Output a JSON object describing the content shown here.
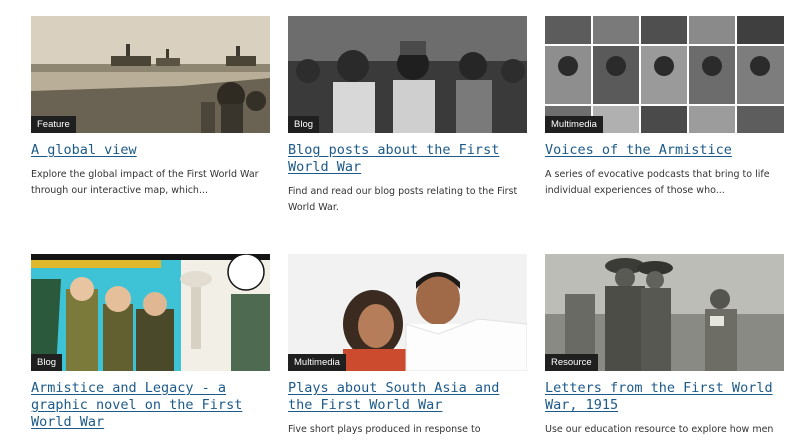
{
  "cards": [
    {
      "tag": "Feature",
      "title": "A global view",
      "description": "Explore the global impact of the First World War through our interactive map, which..."
    },
    {
      "tag": "Blog",
      "title": "Blog posts about the First World War",
      "description": "Find and read our blog posts relating to the First World War."
    },
    {
      "tag": "Multimedia",
      "title": "Voices of the Armistice",
      "description": "A series of evocative podcasts that bring to life individual experiences of those who..."
    },
    {
      "tag": "Blog",
      "title": "Armistice and Legacy - a graphic novel on the First World War",
      "description": ""
    },
    {
      "tag": "Multimedia",
      "title": "Plays about South Asia and the First World War",
      "description": "Five short plays produced in response to"
    },
    {
      "tag": "Resource",
      "title": "Letters from the First World War, 1915",
      "description": "Use our education resource to explore how men"
    }
  ]
}
